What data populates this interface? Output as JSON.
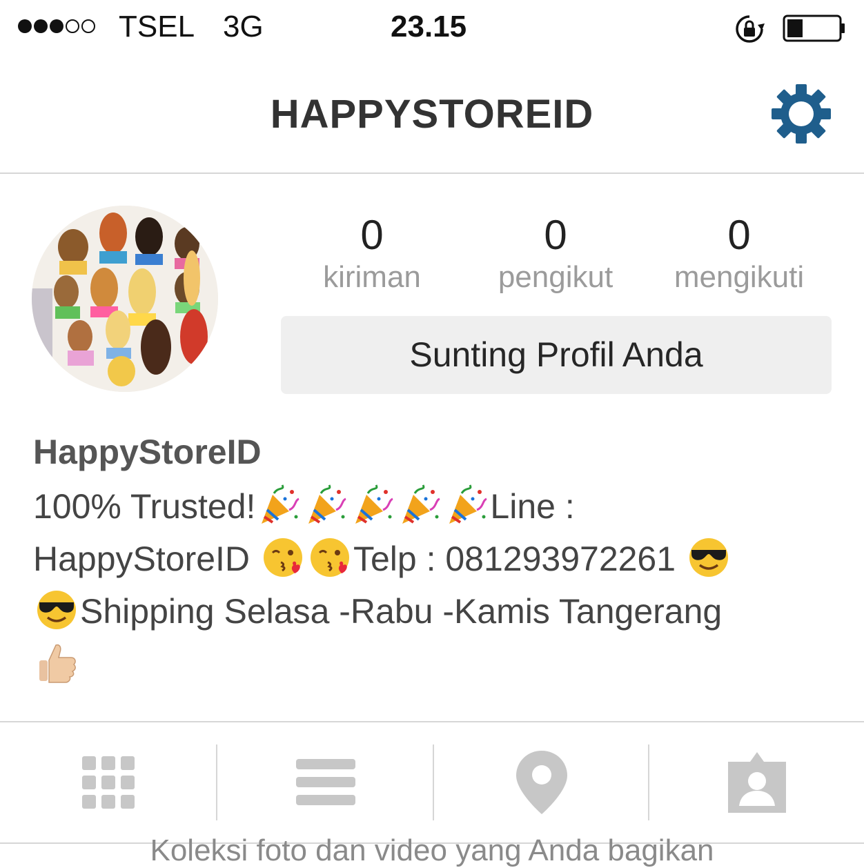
{
  "status_bar": {
    "signal_dots": [
      1,
      1,
      1,
      0,
      0
    ],
    "carrier": "TSEL",
    "network": "3G",
    "time": "23.15",
    "battery_level": 0.3
  },
  "header": {
    "title": "HAPPYSTOREID",
    "settings_icon": "gear-icon",
    "accent_color": "#1f5e8c"
  },
  "profile": {
    "stats": [
      {
        "value": "0",
        "label": "kiriman"
      },
      {
        "value": "0",
        "label": "pengikut"
      },
      {
        "value": "0",
        "label": "mengikuti"
      }
    ],
    "edit_button": "Sunting Profil Anda"
  },
  "bio": {
    "name": "HappyStoreID",
    "line1_text": "100% Trusted!",
    "line1_tail": "Line :",
    "line2_text": "HappyStoreID",
    "line2_tail": "Telp : 081293972261",
    "line3_text": "Shipping Selasa -Rabu -Kamis Tangerang"
  },
  "tabs": [
    {
      "icon": "grid-icon"
    },
    {
      "icon": "list-icon"
    },
    {
      "icon": "location-pin-icon"
    },
    {
      "icon": "tagged-person-icon"
    }
  ],
  "footer": {
    "text": "Koleksi foto dan video yang Anda bagikan"
  }
}
